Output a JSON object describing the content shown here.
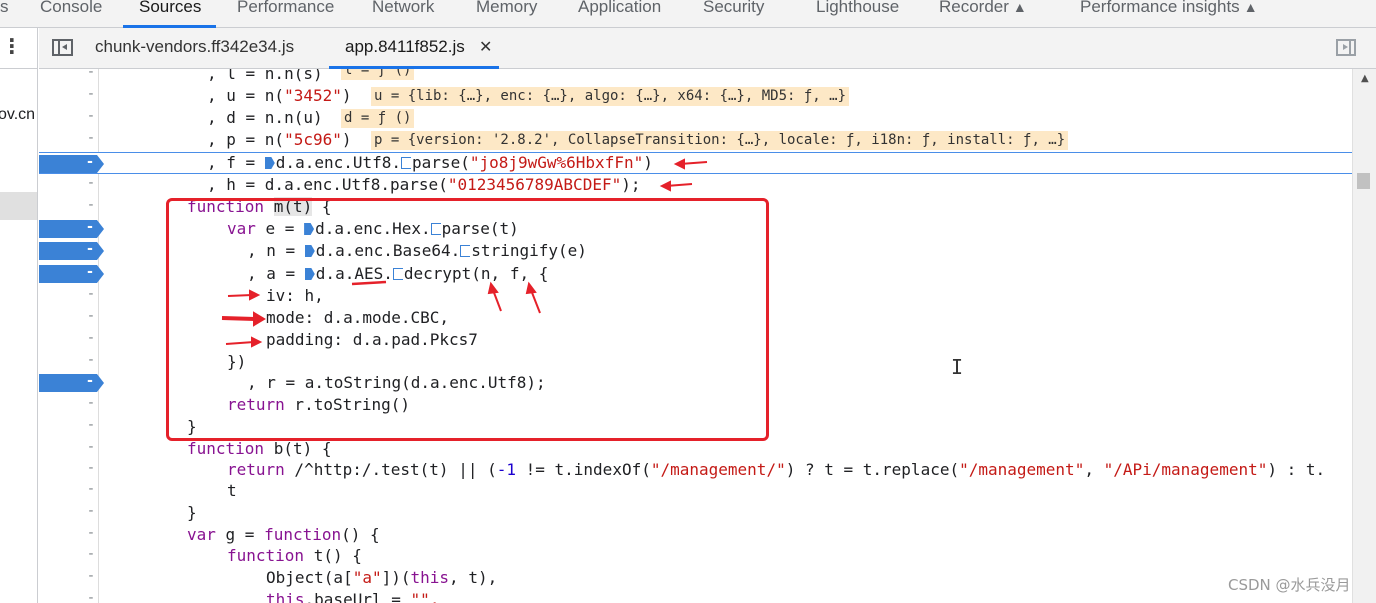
{
  "panel_tabs": [
    {
      "label": "s"
    },
    {
      "label": "Console"
    },
    {
      "label": "Sources"
    },
    {
      "label": "Performance"
    },
    {
      "label": "Network"
    },
    {
      "label": "Memory"
    },
    {
      "label": "Application"
    },
    {
      "label": "Security"
    },
    {
      "label": "Lighthouse"
    },
    {
      "label": "Recorder"
    },
    {
      "label": "Performance insights"
    }
  ],
  "navigator": {
    "partial_text": "ov.cn"
  },
  "file_tabs": [
    {
      "label": "chunk-vendors.ff342e34.js"
    },
    {
      "label": "app.8411f852.js",
      "close": "✕"
    }
  ],
  "gutter_dash": "-",
  "code": {
    "l1": {
      "text": ", l = n.n(s)",
      "inline": "l = ƒ ()"
    },
    "l2": {
      "a": ", u = n(",
      "s": "\"3452\"",
      "b": ")",
      "inline": "u = {lib: {…}, enc: {…}, algo: {…}, x64: {…}, MD5: ƒ, …}"
    },
    "l3": {
      "text": ", d = n.n(u)",
      "inline": "d = ƒ ()"
    },
    "l4": {
      "a": ", p = n(",
      "s": "\"5c96\"",
      "b": ")",
      "inline": "p = {version: '2.8.2', CollapseTransition: {…}, locale: ƒ, i18n: ƒ, install: ƒ, …}"
    },
    "l5": {
      "a": ", f = ",
      "b": "d.a.enc.Utf8.",
      "c": "parse(",
      "s": "\"jo8j9wGw%6HbxfFn\"",
      "d": ")"
    },
    "l6": {
      "a": ", h = d.a.enc.Utf8.parse(",
      "s": "\"0123456789ABCDEF\"",
      "b": ");"
    },
    "l7": {
      "kw": "function",
      "a": " ",
      "hl": "m(t)",
      "b": " {"
    },
    "l8": {
      "kw": "var",
      "a": " e = ",
      "b": "d.a.enc.Hex.",
      "c": "parse(t)"
    },
    "l9": {
      "a": ", n = ",
      "b": "d.a.enc.Base64.",
      "c": "stringify(e)"
    },
    "l10": {
      "a": ", a = ",
      "b": "d.a.AES.",
      "c": "decrypt(n, f, {"
    },
    "l11": {
      "text": "iv: h,"
    },
    "l12": {
      "text": "mode: d.a.mode.CBC,"
    },
    "l13": {
      "text": "padding: d.a.pad.Pkcs7"
    },
    "l14": {
      "text": "})"
    },
    "l15": {
      "text": ", r = a.toString(d.a.enc.Utf8);"
    },
    "l16": {
      "kw": "return",
      "a": " r.toString()"
    },
    "l17": {
      "text": "}"
    },
    "l18": {
      "kw": "function",
      "a": " b(t) {"
    },
    "l19": {
      "kw": "return",
      "a": " /^http:/.test(t) || (",
      "n1": "-1",
      "b": " != t.indexOf(",
      "s1": "\"/management/\"",
      "c": ") ? t = t.replace(",
      "s2": "\"/management\"",
      "d": ", ",
      "s3": "\"/APi/management\"",
      "e": ") : t."
    },
    "l20": {
      "text": "t"
    },
    "l21": {
      "text": "}"
    },
    "l22": {
      "kw": "var",
      "a": " g = ",
      "kw2": "function",
      "b": "() {"
    },
    "l23": {
      "kw": "function",
      "a": " t() {"
    },
    "l24": {
      "a": "Object(a[",
      "s": "\"a\"",
      "b": "])(",
      "kw": "this",
      "c": ", t),"
    },
    "l25": {
      "kw": "this",
      "a": ".baseUrl = ",
      "s": "\"\","
    }
  },
  "watermark": "CSDN @水兵没月",
  "colors": {
    "accent": "#1a73e8",
    "breakpoint": "#3b82d6",
    "annotation_red": "#e5212a",
    "inline_value_bg": "#fde8c6"
  }
}
